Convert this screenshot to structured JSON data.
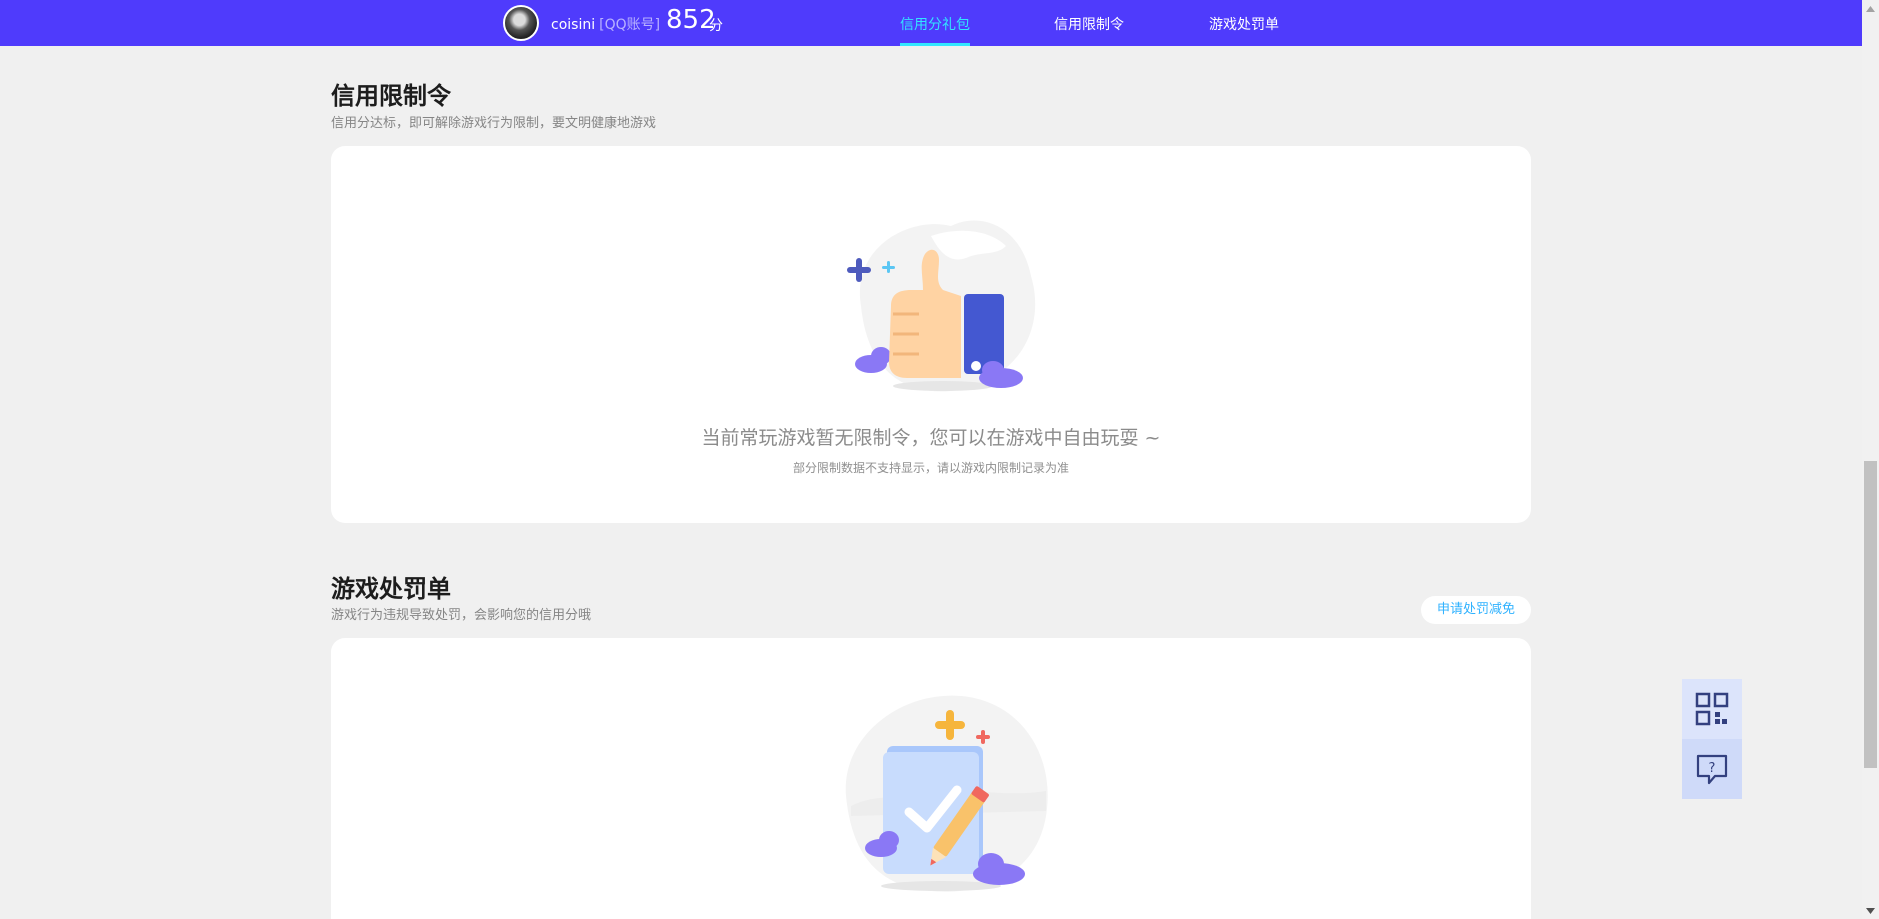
{
  "header": {
    "username": "coisini",
    "account_type": "[QQ账号]",
    "score": "852",
    "score_unit": "分",
    "tabs": [
      {
        "label": "信用分礼包",
        "active": true
      },
      {
        "label": "信用限制令",
        "active": false
      },
      {
        "label": "游戏处罚单",
        "active": false
      }
    ]
  },
  "restriction_section": {
    "title": "信用限制令",
    "subtitle": "信用分达标，即可解除游戏行为限制，要文明健康地游戏",
    "empty_main": "当前常玩游戏暂无限制令，您可以在游戏中自由玩耍 ~",
    "empty_sub": "部分限制数据不支持显示，请以游戏内限制记录为准",
    "illustration": "thumbs-up-illustration"
  },
  "penalty_section": {
    "title": "游戏处罚单",
    "subtitle": "游戏行为违规导致处罚，会影响您的信用分哦",
    "apply_button": "申请处罚减免",
    "illustration": "clipboard-check-illustration"
  },
  "side_float": {
    "icons": [
      "qr-code-icon",
      "help-chat-icon"
    ]
  },
  "colors": {
    "topbar": "#4f3bfc",
    "active_tab": "#32e6ff",
    "page_bg": "#f0f0f0",
    "link_blue": "#2fb2ff"
  }
}
